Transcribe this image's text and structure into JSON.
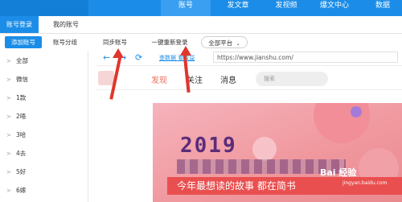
{
  "topnav": {
    "items": [
      {
        "label": "账号",
        "active": true
      },
      {
        "label": "发文章",
        "active": false
      },
      {
        "label": "发视频",
        "active": false
      },
      {
        "label": "爆文中心",
        "active": false
      },
      {
        "label": "数据",
        "active": false
      }
    ]
  },
  "tabs": [
    {
      "label": "账号登录",
      "active": true
    },
    {
      "label": "我的账号",
      "active": false
    }
  ],
  "toolbar": {
    "add_account": "添加账号",
    "account_group": "账号分组",
    "sync_account": "同步账号",
    "relogin": "一键重新登录",
    "platform_select": "全部平台"
  },
  "sidebar": {
    "groups": [
      {
        "label": "全部"
      },
      {
        "label": "微信"
      },
      {
        "label": "1款"
      },
      {
        "label": "2唔"
      },
      {
        "label": "3哈"
      },
      {
        "label": "4去"
      },
      {
        "label": "5好"
      },
      {
        "label": "6嫁"
      }
    ]
  },
  "browser": {
    "link_text": "查数据 看收益",
    "url": "https://www.jianshu.com/"
  },
  "jianshu": {
    "tabs": [
      {
        "label": "发现",
        "active": true
      },
      {
        "label": "关注",
        "active": false
      },
      {
        "label": "消息",
        "active": false
      }
    ],
    "search_placeholder": "搜索",
    "banner_year": "2019",
    "banner_slogan": "今年最想读的故事 都在简书"
  },
  "watermark": {
    "text": "Bai 经验",
    "sub": "jingyan.baidu.com"
  },
  "colors": {
    "accent": "#1b8de8",
    "jianshu_red": "#ea6f5a",
    "arrow": "#e0362c"
  }
}
